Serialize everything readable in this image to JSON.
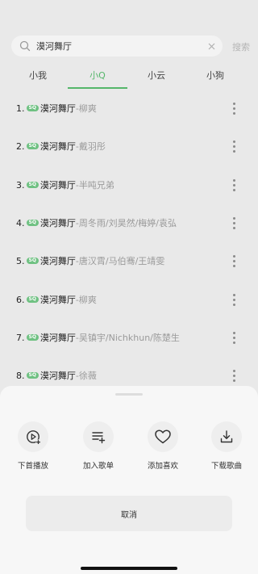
{
  "search": {
    "query": "漠河舞厅",
    "button_label": "搜索"
  },
  "tabs": [
    {
      "label": "小我",
      "active": false
    },
    {
      "label": "小Q",
      "active": true
    },
    {
      "label": "小云",
      "active": false
    },
    {
      "label": "小狗",
      "active": false
    }
  ],
  "songs": [
    {
      "index": "1.",
      "badge": "SQ",
      "title": "漠河舞厅",
      "artist": "-柳爽"
    },
    {
      "index": "2.",
      "badge": "SQ",
      "title": "漠河舞厅",
      "artist": "-戴羽彤"
    },
    {
      "index": "3.",
      "badge": "SQ",
      "title": "漠河舞厅",
      "artist": "-半吨兄弟"
    },
    {
      "index": "4.",
      "badge": "SQ",
      "title": "漠河舞厅",
      "artist": "-周冬雨/刘昊然/梅婷/袁弘"
    },
    {
      "index": "5.",
      "badge": "SQ",
      "title": "漠河舞厅",
      "artist": "-唐汉霄/马伯骞/王靖雯"
    },
    {
      "index": "6.",
      "badge": "SQ",
      "title": "漠河舞厅",
      "artist": "-柳爽"
    },
    {
      "index": "7.",
      "badge": "SQ",
      "title": "漠河舞厅",
      "artist": "-吴镇宇/Nichkhun/陈楚生"
    },
    {
      "index": "8.",
      "badge": "SQ",
      "title": "漠河舞厅",
      "artist": "-徐薇"
    }
  ],
  "sheet": {
    "actions": [
      {
        "label": "下首播放",
        "icon": "play-next-icon"
      },
      {
        "label": "加入歌单",
        "icon": "add-to-playlist-icon"
      },
      {
        "label": "添加喜欢",
        "icon": "heart-icon"
      },
      {
        "label": "下载歌曲",
        "icon": "download-icon"
      }
    ],
    "cancel_label": "取消"
  },
  "colors": {
    "accent": "#55b66a",
    "badge": "#6fc182",
    "sheet_bg": "#f7f7f7",
    "overlay_bg": "#e9e9e9"
  }
}
